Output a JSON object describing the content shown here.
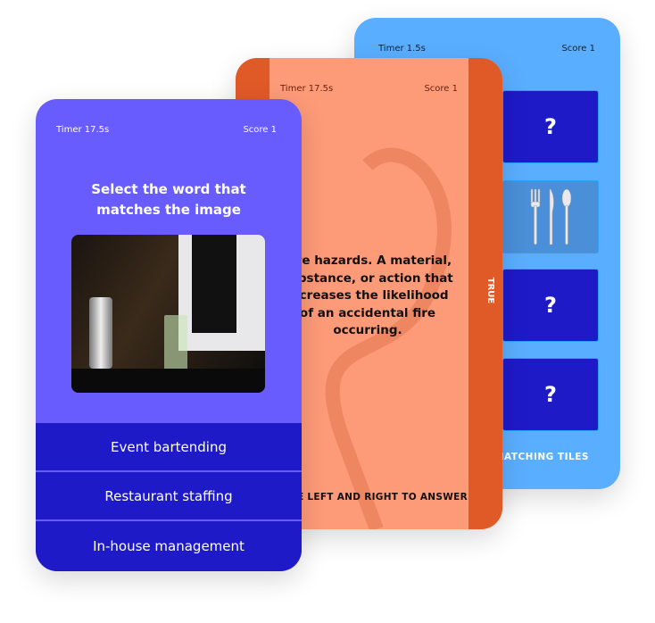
{
  "blue_card": {
    "timer": "Timer 1.5s",
    "score": "Score 1",
    "tiles": [
      "?",
      "",
      "?",
      "?"
    ],
    "footer": "MATCHING TILES",
    "tile_image": "cutlery-fork-knife-spoon"
  },
  "orange_card": {
    "timer": "Timer 17.5s",
    "score": "Score 1",
    "statement": "Fire hazards. A material, substance, or action that increases the likelihood of an accidental fire occurring.",
    "side_label": "TRUE",
    "footer": "SWIPE LEFT AND RIGHT TO ANSWER"
  },
  "purple_card": {
    "timer": "Timer 17.5s",
    "score": "Score 1",
    "question": "Select the word that matches the image",
    "image": "bartender-mixing-cocktail",
    "answers": [
      "Event bartending",
      "Restaurant staffing",
      "In-house management"
    ]
  },
  "colors": {
    "blue": "#5aaeff",
    "orange": "#fd9a78",
    "orange_dark": "#e05a28",
    "purple": "#685cff",
    "navy": "#1e1ac8"
  }
}
